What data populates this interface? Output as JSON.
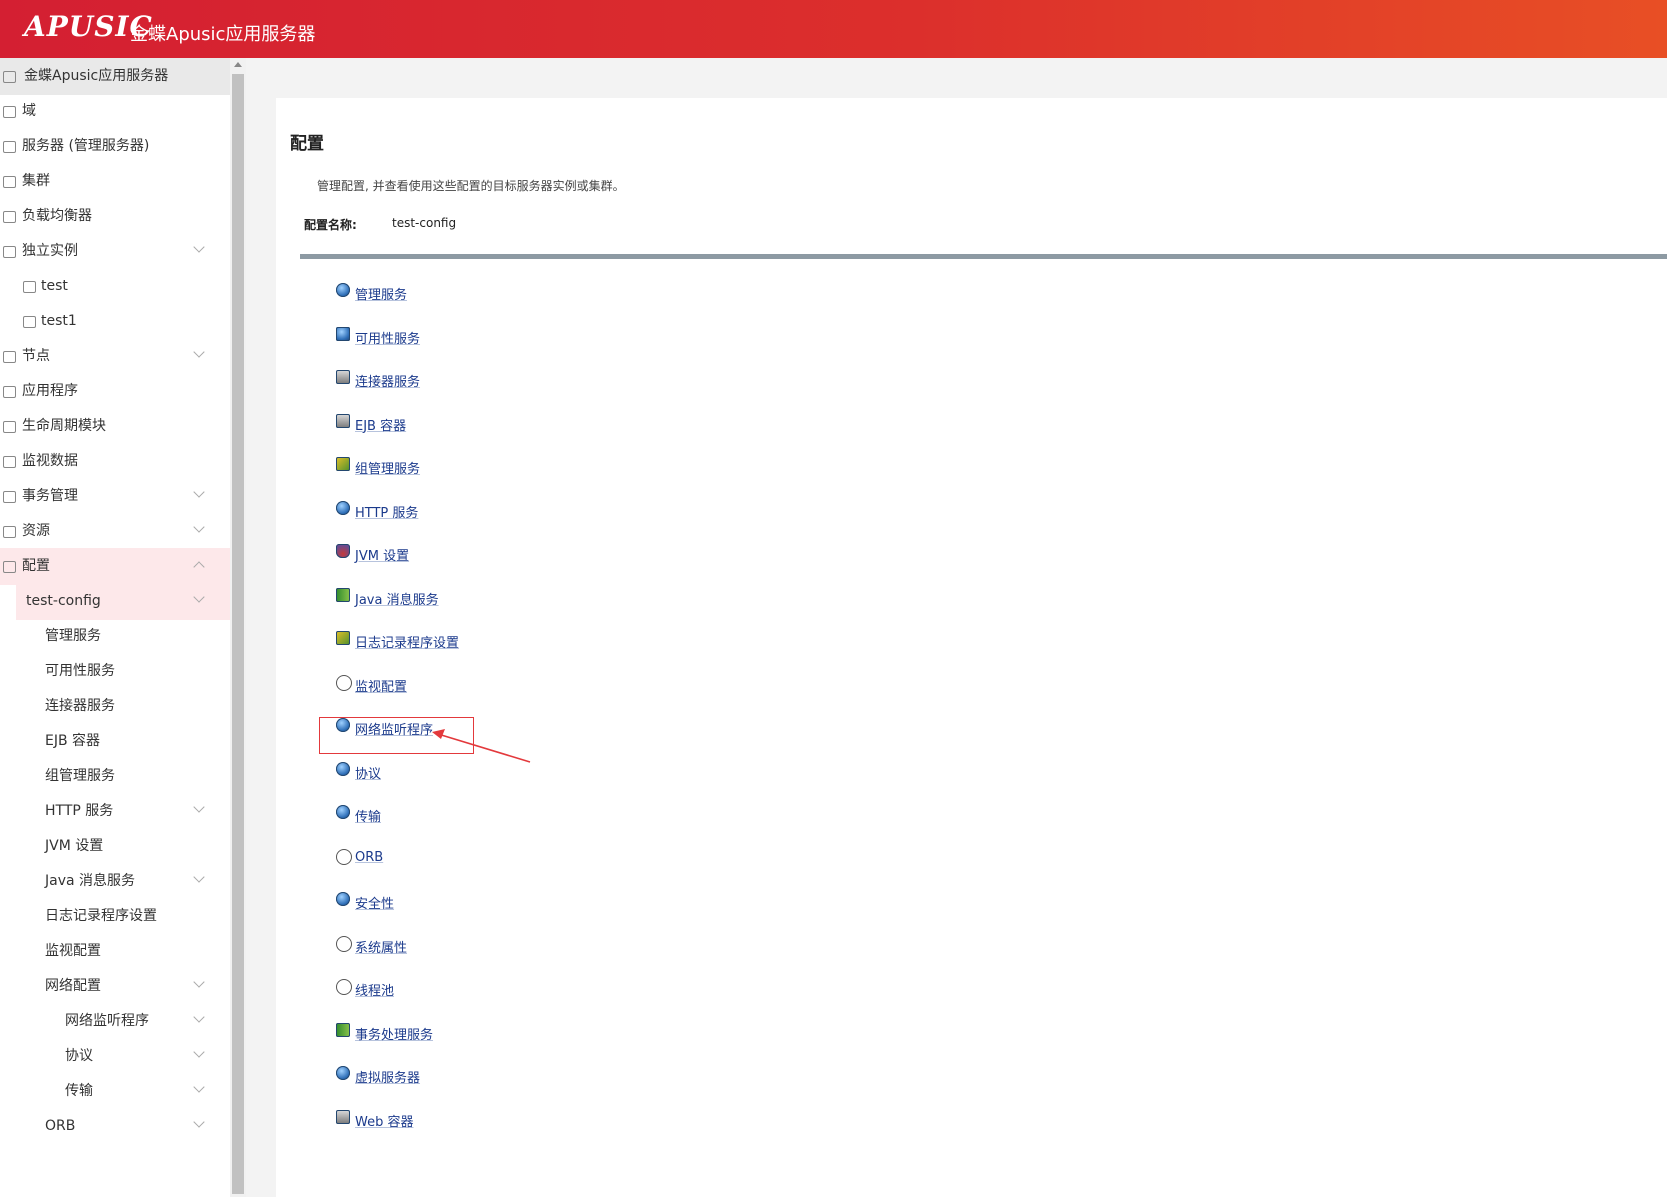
{
  "header": {
    "logo_text": "APUSIC",
    "title": "金蝶Apusic应用服务器"
  },
  "sidebar": {
    "items": [
      {
        "label": "金蝶Apusic应用服务器",
        "icon": "server-icon",
        "expand": "none"
      },
      {
        "label": "域",
        "icon": "globe-icon",
        "expand": "none"
      },
      {
        "label": "服务器 (管理服务器)",
        "icon": "server-icon",
        "expand": "none"
      },
      {
        "label": "集群",
        "icon": "cluster-icon",
        "expand": "none"
      },
      {
        "label": "负载均衡器",
        "icon": "balancer-icon",
        "expand": "none"
      },
      {
        "label": "独立实例",
        "icon": "instance-icon",
        "expand": "collapsed"
      },
      {
        "label": "test",
        "icon": "instance-icon",
        "expand": "none"
      },
      {
        "label": "test1",
        "icon": "instance-icon",
        "expand": "none"
      },
      {
        "label": "节点",
        "icon": "node-icon",
        "expand": "collapsed"
      },
      {
        "label": "应用程序",
        "icon": "apps-icon",
        "expand": "none"
      },
      {
        "label": "生命周期模块",
        "icon": "lifecycle-icon",
        "expand": "none"
      },
      {
        "label": "监视数据",
        "icon": "monitor-icon",
        "expand": "none"
      },
      {
        "label": "事务管理",
        "icon": "transaction-icon",
        "expand": "collapsed"
      },
      {
        "label": "资源",
        "icon": "layers-icon",
        "expand": "collapsed"
      },
      {
        "label": "配置",
        "icon": "sliders-icon",
        "expand": "expanded"
      },
      {
        "label": "test-config",
        "icon": "",
        "expand": "collapsed"
      },
      {
        "label": "管理服务",
        "icon": "",
        "expand": "none"
      },
      {
        "label": "可用性服务",
        "icon": "",
        "expand": "none"
      },
      {
        "label": "连接器服务",
        "icon": "",
        "expand": "none"
      },
      {
        "label": "EJB 容器",
        "icon": "",
        "expand": "none"
      },
      {
        "label": "组管理服务",
        "icon": "",
        "expand": "none"
      },
      {
        "label": "HTTP 服务",
        "icon": "",
        "expand": "collapsed"
      },
      {
        "label": "JVM 设置",
        "icon": "",
        "expand": "none"
      },
      {
        "label": "Java 消息服务",
        "icon": "",
        "expand": "collapsed"
      },
      {
        "label": "日志记录程序设置",
        "icon": "",
        "expand": "none"
      },
      {
        "label": "监视配置",
        "icon": "",
        "expand": "none"
      },
      {
        "label": "网络配置",
        "icon": "",
        "expand": "collapsed"
      },
      {
        "label": "网络监听程序",
        "icon": "",
        "expand": "collapsed"
      },
      {
        "label": "协议",
        "icon": "",
        "expand": "collapsed"
      },
      {
        "label": "传输",
        "icon": "",
        "expand": "collapsed"
      },
      {
        "label": "ORB",
        "icon": "",
        "expand": "collapsed"
      }
    ]
  },
  "main": {
    "title": "配置",
    "description": "管理配置, 并查看使用这些配置的目标服务器实例或集群。",
    "config_name_label": "配置名称:",
    "config_name_value": "test-config",
    "links": [
      {
        "label": "管理服务",
        "icon": "globe-icon"
      },
      {
        "label": "可用性服务",
        "icon": "monitor-icon"
      },
      {
        "label": "连接器服务",
        "icon": "connector-icon"
      },
      {
        "label": "EJB 容器",
        "icon": "container-icon"
      },
      {
        "label": "组管理服务",
        "icon": "group-icon"
      },
      {
        "label": "HTTP 服务",
        "icon": "globe-icon"
      },
      {
        "label": "JVM 设置",
        "icon": "java-cup-icon"
      },
      {
        "label": "Java 消息服务",
        "icon": "exchange-arrows-icon"
      },
      {
        "label": "日志记录程序设置",
        "icon": "log-icon"
      },
      {
        "label": "监视配置",
        "icon": "monitor-eye-icon"
      },
      {
        "label": "网络监听程序",
        "icon": "globe-icon"
      },
      {
        "label": "协议",
        "icon": "globe-icon"
      },
      {
        "label": "传输",
        "icon": "globe-icon"
      },
      {
        "label": "ORB",
        "icon": "orb-icon"
      },
      {
        "label": "安全性",
        "icon": "globe-icon"
      },
      {
        "label": "系统属性",
        "icon": "properties-icon"
      },
      {
        "label": "线程池",
        "icon": "thread-pool-icon"
      },
      {
        "label": "事务处理服务",
        "icon": "exchange-arrows-icon"
      },
      {
        "label": "虚拟服务器",
        "icon": "globe-icon"
      },
      {
        "label": "Web 容器",
        "icon": "container-icon"
      }
    ],
    "highlighted_link": "网络监听程序"
  },
  "colors": {
    "header_start": "#d41f32",
    "header_end": "#e84f25",
    "active_row": "#fde8ea",
    "link": "#1b3a8c",
    "divider": "#8d9aa3",
    "annotation": "#e3393c"
  }
}
